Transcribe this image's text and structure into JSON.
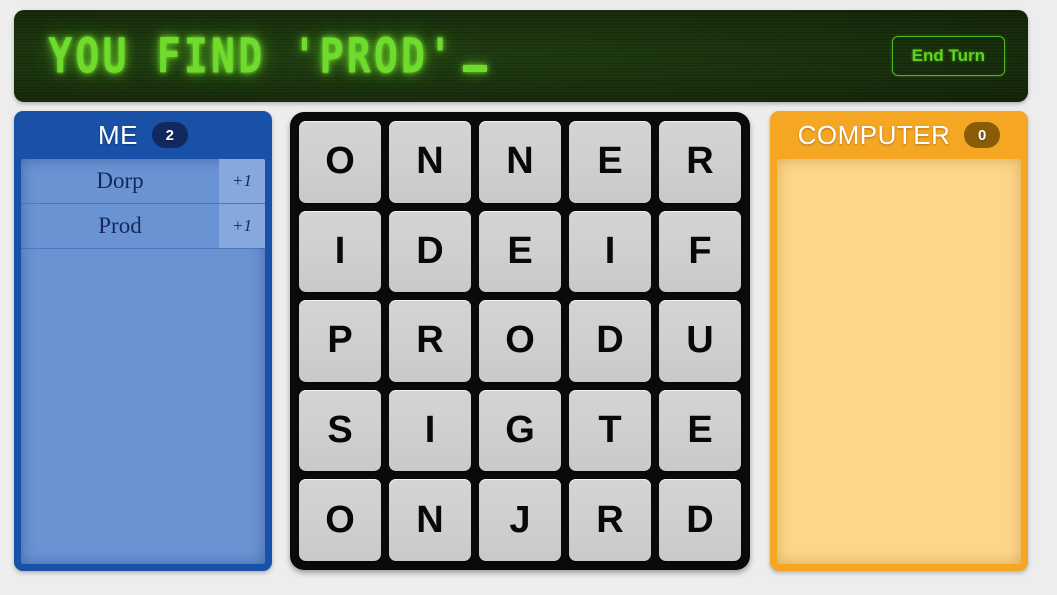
{
  "banner": {
    "message": "YOU FIND 'PROD'",
    "cursor": "_",
    "end_turn_label": "End Turn",
    "text_color": "#6fdb2c",
    "background_color": "#14290a"
  },
  "players": [
    {
      "name": "ME",
      "score": "2",
      "accent_color": "#1a51a8",
      "body_color": "#6a93d4",
      "words": [
        {
          "word": "Dorp",
          "points": "+1"
        },
        {
          "word": "Prod",
          "points": "+1"
        }
      ]
    },
    {
      "name": "COMPUTER",
      "score": "0",
      "accent_color": "#f5a623",
      "body_color": "#fcd68b",
      "words": []
    }
  ],
  "board": {
    "rows": 5,
    "cols": 5,
    "letters": [
      [
        "O",
        "N",
        "N",
        "E",
        "R"
      ],
      [
        "I",
        "D",
        "E",
        "I",
        "F"
      ],
      [
        "P",
        "R",
        "O",
        "D",
        "U"
      ],
      [
        "S",
        "I",
        "G",
        "T",
        "E"
      ],
      [
        "O",
        "N",
        "J",
        "R",
        "D"
      ]
    ],
    "tile_color": "#d0d0d0",
    "background_color": "#0a0a0a"
  }
}
